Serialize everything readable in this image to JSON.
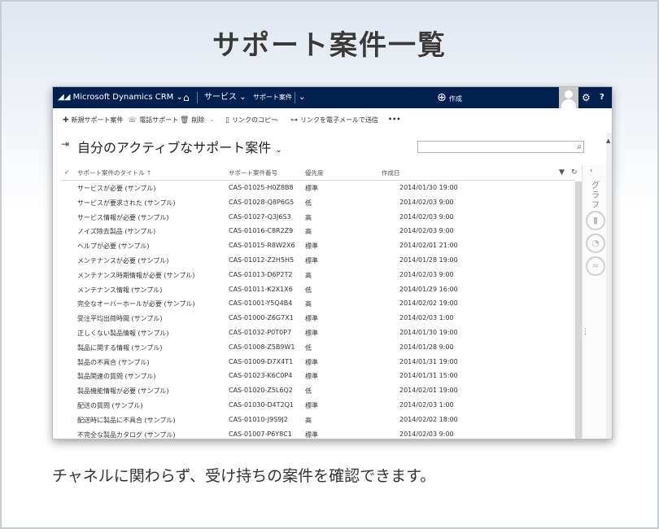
{
  "page": {
    "headline": "サポート案件一覧",
    "caption": "チャネルに関わらず、受け持ちの案件を確認できます。"
  },
  "topbar": {
    "brand": "Microsoft Dynamics CRM",
    "home_icon": "home-icon",
    "area": "サービス",
    "entity": "サポート案件",
    "create": "作成",
    "help": "?"
  },
  "commands": {
    "new": "新規サポート案件",
    "phone": "電話サポート",
    "delete": "削除",
    "copy_link": "リンクのコピー",
    "email_link": "リンクを電子メールで送信",
    "more": "•••"
  },
  "view": {
    "title": "自分のアクティブなサポート案件",
    "search_value": "",
    "side_label": "グラフ"
  },
  "grid": {
    "columns": [
      "サポート案件のタイトル ↑",
      "サポート案件番号",
      "優先度",
      "作成日"
    ],
    "rows": [
      [
        "サービスが必要 (サンプル)",
        "CAS-01025-H0Z8B8",
        "標準",
        "2014/01/30 19:00"
      ],
      [
        "サービスが要求された (サンプル)",
        "CAS-01028-Q8P6G5",
        "低",
        "2014/02/03 9:00"
      ],
      [
        "サービス情報が必要 (サンプル)",
        "CAS-01027-Q3J6S3",
        "高",
        "2014/02/03 9:00"
      ],
      [
        "ノイズ除去製品 (サンプル)",
        "CAS-01016-C8R2Z9",
        "高",
        "2014/02/03 9:00"
      ],
      [
        "ヘルプが必要 (サンプル)",
        "CAS-01015-R8W2X6",
        "標準",
        "2014/02/01 21:00"
      ],
      [
        "メンテナンスが必要 (サンプル)",
        "CAS-01012-Z2H5H5",
        "標準",
        "2014/01/28 19:00"
      ],
      [
        "メンテナンス時期情報が必要 (サンプル)",
        "CAS-01013-D6P2T2",
        "高",
        "2014/02/03 9:00"
      ],
      [
        "メンテナンス情報 (サンプル)",
        "CAS-01011-K2X1X6",
        "低",
        "2014/01/29 16:00"
      ],
      [
        "完全なオーバーホールが必要 (サンプル)",
        "CAS-01001-Y5Q4B4",
        "高",
        "2014/02/02 19:00"
      ],
      [
        "受注平均出荷時間 (サンプル)",
        "CAS-01000-Z6G7X1",
        "標準",
        "2014/02/03 1:00"
      ],
      [
        "正しくない製品情報 (サンプル)",
        "CAS-01032-P0T0P7",
        "標準",
        "2014/01/30 19:00"
      ],
      [
        "製品に関する情報 (サンプル)",
        "CAS-01008-Z5B9W1",
        "低",
        "2014/01/28 9:00"
      ],
      [
        "製品の不具合 (サンプル)",
        "CAS-01009-D7X4T1",
        "標準",
        "2014/01/31 19:00"
      ],
      [
        "製品関連の質問 (サンプル)",
        "CAS-01023-K6C0P4",
        "標準",
        "2014/01/31 15:00"
      ],
      [
        "製品機能情報が必要 (サンプル)",
        "CAS-01020-Z5L6Q2",
        "低",
        "2014/02/01 19:00"
      ],
      [
        "配送の質問 (サンプル)",
        "CAS-01030-D4T2Q1",
        "標準",
        "2014/02/03 1:00"
      ],
      [
        "配送時に製品に不具合 (サンプル)",
        "CAS-01010-J9S9J2",
        "高",
        "2014/02/02 18:00"
      ],
      [
        "不完全な製品カタログ (サンプル)",
        "CAS-01007-P6Y8C1",
        "標準",
        "2014/02/03 9:00"
      ]
    ]
  }
}
